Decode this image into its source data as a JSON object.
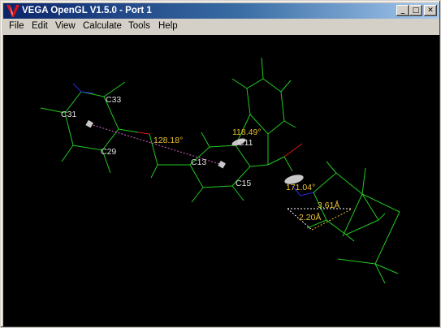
{
  "window": {
    "title": "VEGA OpenGL V1.5.0 - Port 1",
    "icon": "vega-logo-icon",
    "controls": {
      "minimize": "_",
      "maximize": "□",
      "close": "✕"
    }
  },
  "menu": {
    "items": [
      "File",
      "Edit",
      "View",
      "Calculate",
      "Tools",
      "Help"
    ]
  },
  "viewer": {
    "background": "#000000",
    "colors": {
      "carbon": "#22c822",
      "oxygen": "#e01818",
      "nitrogen": "#2828e0",
      "hydrogen": "#e0e0e0",
      "measure": "#e8c030",
      "distance": "#ffffff"
    },
    "atom_labels": [
      "C31",
      "C33",
      "C29",
      "C13",
      "C11",
      "C15"
    ],
    "measurements": [
      "128.18°",
      "118.49°",
      "171.04°",
      "3.61Å",
      "2.20Å"
    ]
  }
}
